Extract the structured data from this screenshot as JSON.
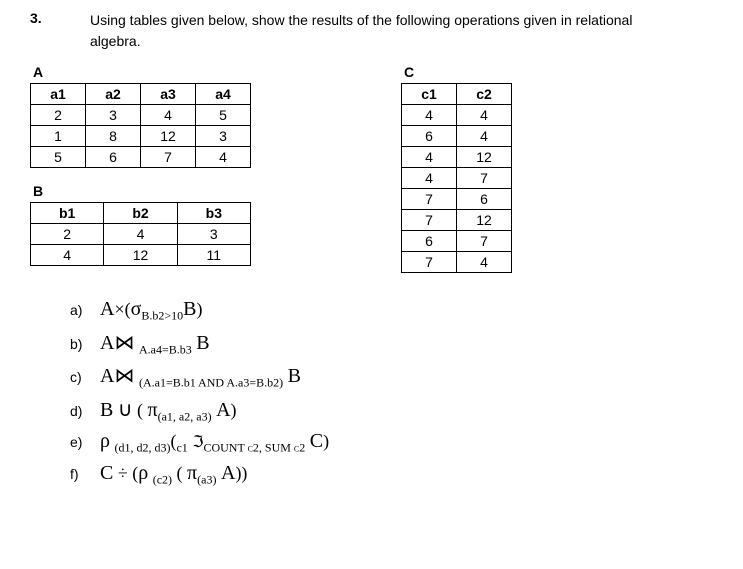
{
  "question": {
    "number": "3.",
    "text_part1": "Using tables given below, show the results of the following operations given in relational",
    "text_part2": "algebra."
  },
  "tables": {
    "A": {
      "label": "A",
      "headers": [
        "a1",
        "a2",
        "a3",
        "a4"
      ],
      "rows": [
        [
          "2",
          "3",
          "4",
          "5"
        ],
        [
          "1",
          "8",
          "12",
          "3"
        ],
        [
          "5",
          "6",
          "7",
          "4"
        ]
      ]
    },
    "B": {
      "label": "B",
      "headers": [
        "b1",
        "b2",
        "b3"
      ],
      "rows": [
        [
          "2",
          "4",
          "3"
        ],
        [
          "4",
          "12",
          "11"
        ]
      ]
    },
    "C": {
      "label": "C",
      "headers": [
        "c1",
        "c2"
      ],
      "rows": [
        [
          "4",
          "4"
        ],
        [
          "6",
          "4"
        ],
        [
          "4",
          "12"
        ],
        [
          "4",
          "7"
        ],
        [
          "7",
          "6"
        ],
        [
          "7",
          "12"
        ],
        [
          "6",
          "7"
        ],
        [
          "7",
          "4"
        ]
      ]
    }
  },
  "formulas": {
    "a": {
      "label": "a)",
      "text_A": "A",
      "text_x": "×",
      "text_sigma": "σ",
      "text_sub1": "B.b2>10",
      "text_B": "B",
      "text_open": "(",
      "text_close": ")"
    },
    "b": {
      "label": "b)",
      "text_A": "A",
      "text_join": "⋈",
      "text_sub": "A.a4=B.b3",
      "text_B": "B"
    },
    "c": {
      "label": "c)",
      "text_A": "A",
      "text_join": "⋈",
      "text_sub": "(A.a1=B.b1 AND A.a3=B.b2)",
      "text_B": "B"
    },
    "d": {
      "label": "d)",
      "text_B": "B",
      "text_union": "∪",
      "text_open": "(",
      "text_pi": "π",
      "text_sub": "(a1, a2, a3)",
      "text_A": "A",
      "text_close": ")"
    },
    "e": {
      "label": "e)",
      "text_rho": "ρ",
      "text_sub1": "(d1, d2, d3)",
      "text_open": "(",
      "text_c1": "c1",
      "text_f": "ℑ",
      "text_count": "COUNT c2, SUM c2",
      "text_C": "C",
      "text_close": ")"
    },
    "f": {
      "label": "f)",
      "text_C": "C",
      "text_div": "÷",
      "text_open1": "(",
      "text_rho": "ρ",
      "text_sub1": "(c2)",
      "text_open2": "(",
      "text_pi": "π",
      "text_sub2": "(a3)",
      "text_A": "A",
      "text_close": "))"
    }
  }
}
